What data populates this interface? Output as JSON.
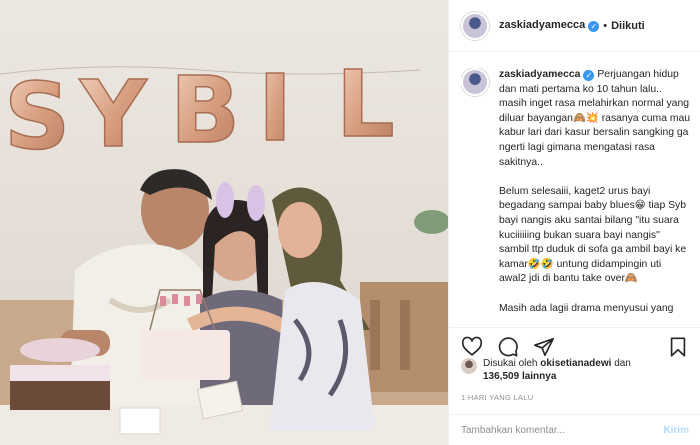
{
  "post": {
    "username": "zaskiadyamecca",
    "follow_status": "Diikuti",
    "dot": "•",
    "verified_mark": "✓",
    "photo_balloons": "SYBIL",
    "caption": {
      "username": "zaskiadyamecca",
      "text": " Perjuangan hidup dan mati pertama ko 10 tahun lalu.. masih inget rasa melahirkan normal yang diluar bayangan🙈💥 rasanya cuma mau kabur lari dari kasur bersalin sangking ga ngerti lagi gimana mengatasi rasa sakitnya..\n\nBelum selesaiii, kaget2 urus bayi begadang sampai baby blues😁 tiap Syb bayi nangis aku santai bilang \"itu suara kuciiiiiing bukan suara bayi nangis\" sambil ttp duduk di sofa ga ambil bayi ke kamar🤣🤣 untung didampingin uti awal2 jdi di bantu take over🙈\n\nMasih ada lagii drama menyusui yang"
    },
    "likes": {
      "prefix": "Disukai oleh",
      "first_user": "okisetianadewi",
      "connector": "dan",
      "count": "136,509",
      "suffix": "lainnya"
    },
    "timestamp": "1 HARI YANG LALU",
    "comment": {
      "placeholder": "Tambahkan komentar...",
      "post_label": "Kirim"
    },
    "icons": {
      "like": "heart-icon",
      "comment": "comment-icon",
      "share": "share-icon",
      "save": "bookmark-icon"
    }
  }
}
